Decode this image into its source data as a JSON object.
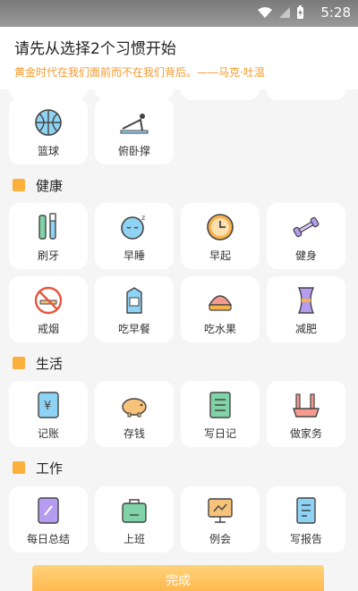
{
  "status_bar": {
    "time": "5:28"
  },
  "header": {
    "title": "请先从选择2个习惯开始",
    "quote": "黄金时代在我们面前而不在我们背后。——马克·吐温"
  },
  "sections": [
    {
      "title": "",
      "items": [
        {
          "label": "篮球",
          "icon": "basketball-icon"
        },
        {
          "label": "俯卧撑",
          "icon": "pushup-icon"
        }
      ]
    },
    {
      "title": "健康",
      "items": [
        {
          "label": "刷牙",
          "icon": "toothbrush-icon"
        },
        {
          "label": "早睡",
          "icon": "sleep-icon"
        },
        {
          "label": "早起",
          "icon": "clock-icon"
        },
        {
          "label": "健身",
          "icon": "dumbbell-icon"
        },
        {
          "label": "戒烟",
          "icon": "no-smoking-icon"
        },
        {
          "label": "吃早餐",
          "icon": "milk-icon"
        },
        {
          "label": "吃水果",
          "icon": "fruit-icon"
        },
        {
          "label": "减肥",
          "icon": "waist-icon"
        }
      ]
    },
    {
      "title": "生活",
      "items": [
        {
          "label": "记账",
          "icon": "ledger-icon"
        },
        {
          "label": "存钱",
          "icon": "piggy-bank-icon"
        },
        {
          "label": "写日记",
          "icon": "diary-icon"
        },
        {
          "label": "做家务",
          "icon": "broom-icon"
        }
      ]
    },
    {
      "title": "工作",
      "items": [
        {
          "label": "每日总结",
          "icon": "notebook-icon"
        },
        {
          "label": "上班",
          "icon": "briefcase-icon"
        },
        {
          "label": "例会",
          "icon": "presentation-icon"
        },
        {
          "label": "写报告",
          "icon": "report-icon"
        }
      ]
    }
  ],
  "done_button": {
    "label": "完成"
  }
}
